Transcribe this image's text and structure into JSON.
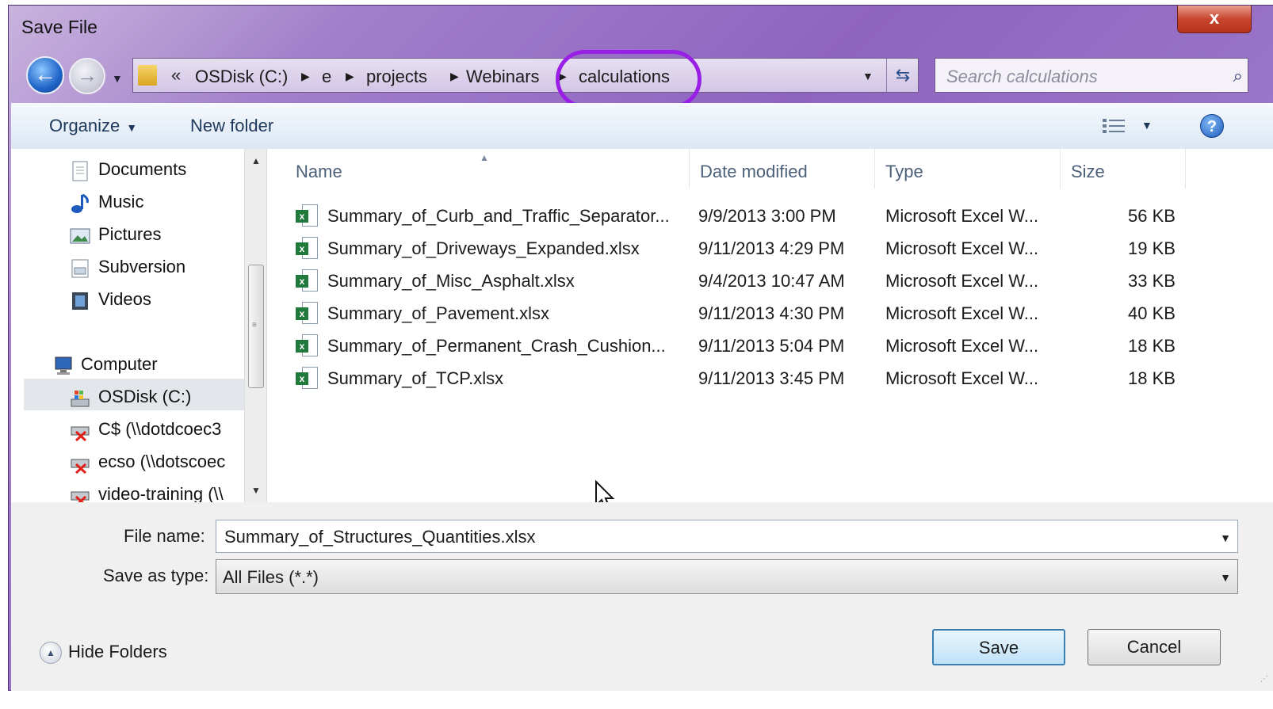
{
  "window": {
    "title": "Save File",
    "close_label": "x"
  },
  "address": {
    "chevrons": "«",
    "crumbs": [
      "OSDisk (C:)",
      "e",
      "projects",
      "Webinars",
      "calculations"
    ],
    "highlighted_crumb": "calculations",
    "highlight_color": "#9a1fe6"
  },
  "search": {
    "placeholder": "Search calculations"
  },
  "toolbar": {
    "organize": "Organize",
    "new_folder": "New folder",
    "help": "?"
  },
  "nav": {
    "items": [
      {
        "label": "Documents",
        "icon": "document-icon"
      },
      {
        "label": "Music",
        "icon": "music-icon"
      },
      {
        "label": "Pictures",
        "icon": "pictures-icon"
      },
      {
        "label": "Subversion",
        "icon": "subversion-icon"
      },
      {
        "label": "Videos",
        "icon": "videos-icon"
      },
      {
        "label": "Computer",
        "icon": "computer-icon"
      },
      {
        "label": "OSDisk (C:)",
        "icon": "drive-icon",
        "selected": true
      },
      {
        "label": "C$ (\\\\dotdcoec3",
        "icon": "network-drive-disconnected-icon"
      },
      {
        "label": "ecso (\\\\dotscoec",
        "icon": "network-drive-disconnected-icon"
      },
      {
        "label": "video-training (\\\\",
        "icon": "network-drive-disconnected-icon"
      }
    ]
  },
  "files": {
    "columns": [
      "Name",
      "Date modified",
      "Type",
      "Size"
    ],
    "rows": [
      {
        "name": "Summary_of_Curb_and_Traffic_Separator...",
        "date": "9/9/2013 3:00 PM",
        "type": "Microsoft Excel W...",
        "size": "56 KB"
      },
      {
        "name": "Summary_of_Driveways_Expanded.xlsx",
        "date": "9/11/2013 4:29 PM",
        "type": "Microsoft Excel W...",
        "size": "19 KB"
      },
      {
        "name": "Summary_of_Misc_Asphalt.xlsx",
        "date": "9/4/2013 10:47 AM",
        "type": "Microsoft Excel W...",
        "size": "33 KB"
      },
      {
        "name": "Summary_of_Pavement.xlsx",
        "date": "9/11/2013 4:30 PM",
        "type": "Microsoft Excel W...",
        "size": "40 KB"
      },
      {
        "name": "Summary_of_Permanent_Crash_Cushion...",
        "date": "9/11/2013 5:04 PM",
        "type": "Microsoft Excel W...",
        "size": "18 KB"
      },
      {
        "name": "Summary_of_TCP.xlsx",
        "date": "9/11/2013 3:45 PM",
        "type": "Microsoft Excel W...",
        "size": "18 KB"
      }
    ]
  },
  "form": {
    "file_name_label": "File name:",
    "file_name_value": "Summary_of_Structures_Quantities.xlsx",
    "save_type_label": "Save as type:",
    "save_type_value": "All Files (*.*)"
  },
  "footer": {
    "hide_folders": "Hide Folders",
    "save": "Save",
    "cancel": "Cancel"
  }
}
